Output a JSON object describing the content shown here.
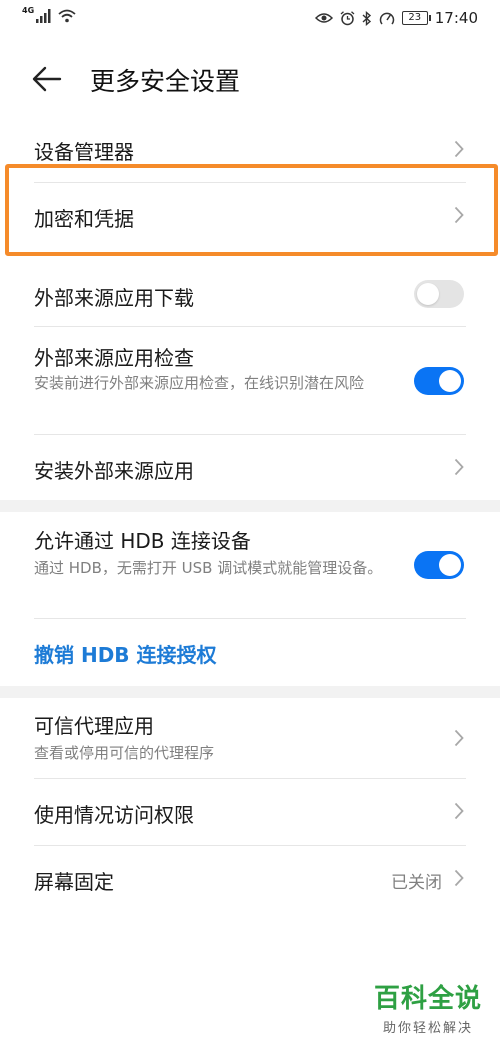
{
  "status_bar": {
    "network": "4G",
    "battery": "23",
    "time": "17:40"
  },
  "header": {
    "title": "更多安全设置"
  },
  "items": [
    {
      "label": "设备管理器"
    },
    {
      "label": "加密和凭据"
    },
    {
      "label": "外部来源应用下载",
      "toggle": "off"
    },
    {
      "label": "外部来源应用检查",
      "subtitle": "安装前进行外部来源应用检查，在线识别潜在风险",
      "toggle": "on"
    },
    {
      "label": "安装外部来源应用"
    },
    {
      "label": "允许通过 HDB 连接设备",
      "subtitle": "通过 HDB，无需打开 USB 调试模式就能管理设备。",
      "toggle": "on"
    },
    {
      "label": "撤销 HDB 连接授权"
    },
    {
      "label": "可信代理应用",
      "subtitle": "查看或停用可信的代理程序"
    },
    {
      "label": "使用情况访问权限"
    },
    {
      "label": "屏幕固定",
      "value": "已关闭"
    }
  ],
  "watermark": {
    "main": "百科全说",
    "sub": "助你轻松解决"
  },
  "colors": {
    "accent": "#0a74f4",
    "link": "#1d7bd6",
    "highlight": "#f58b2a",
    "watermark": "#2ea043"
  }
}
